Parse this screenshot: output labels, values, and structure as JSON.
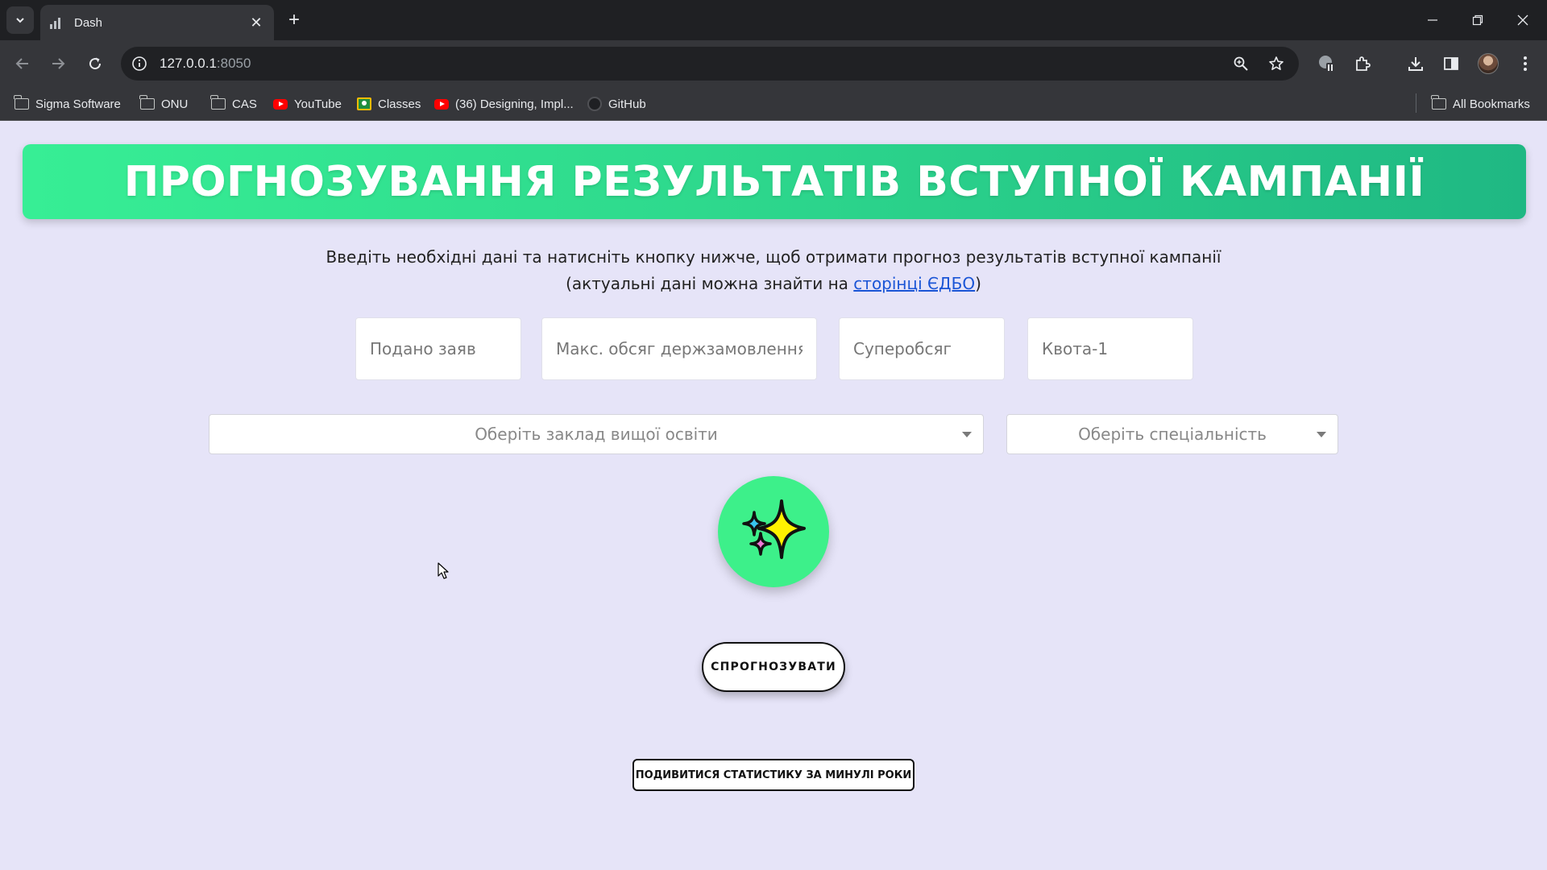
{
  "browser": {
    "tab": {
      "title": "Dash"
    },
    "address": {
      "host": "127.0.0.1",
      "port": ":8050"
    },
    "bookmarks": [
      {
        "label": "Sigma Software",
        "icon": "folder-icon"
      },
      {
        "label": "ONU",
        "icon": "folder-icon"
      },
      {
        "label": "CAS",
        "icon": "folder-icon"
      },
      {
        "label": "YouTube",
        "icon": "youtube-icon"
      },
      {
        "label": "Classes",
        "icon": "classroom-icon"
      },
      {
        "label": "(36) Designing, Impl...",
        "icon": "youtube-icon"
      },
      {
        "label": "GitHub",
        "icon": "github-icon"
      }
    ],
    "all_bookmarks": "All Bookmarks"
  },
  "page": {
    "banner_title": "ПРОГНОЗУВАННЯ РЕЗУЛЬТАТІВ ВСТУПНОЇ КАМПАНІЇ",
    "intro_line1": "Введіть необхідні дані та натисніть кнопку нижче, щоб отримати прогноз результатів вступної кампанії",
    "intro_line2_prefix": "(актуальні дані можна знайти на ",
    "intro_link": "сторінці ЄДБО",
    "intro_line2_suffix": ")",
    "inputs": {
      "applications": {
        "placeholder": "Подано заяв",
        "value": ""
      },
      "max_state_order": {
        "placeholder": "Макс. обсяг держзамовлення",
        "value": ""
      },
      "super_volume": {
        "placeholder": "Суперобсяг",
        "value": ""
      },
      "quota1": {
        "placeholder": "Квота-1",
        "value": ""
      }
    },
    "selects": {
      "institution": {
        "placeholder": "Оберіть заклад вищої освіти"
      },
      "specialty": {
        "placeholder": "Оберіть спеціальність"
      }
    },
    "predict_button": "СПРОГНОЗУВАТИ",
    "stats_button": "ПОДИВИТИСЯ СТАТИСТИКУ ЗА МИНУЛІ РОКИ"
  },
  "colors": {
    "page_bg": "#e6e4f8",
    "banner_gradient_start": "#37ee95",
    "banner_gradient_end": "#1fb883",
    "sparkle_circle": "#3df08a",
    "link": "#1a55d6"
  }
}
